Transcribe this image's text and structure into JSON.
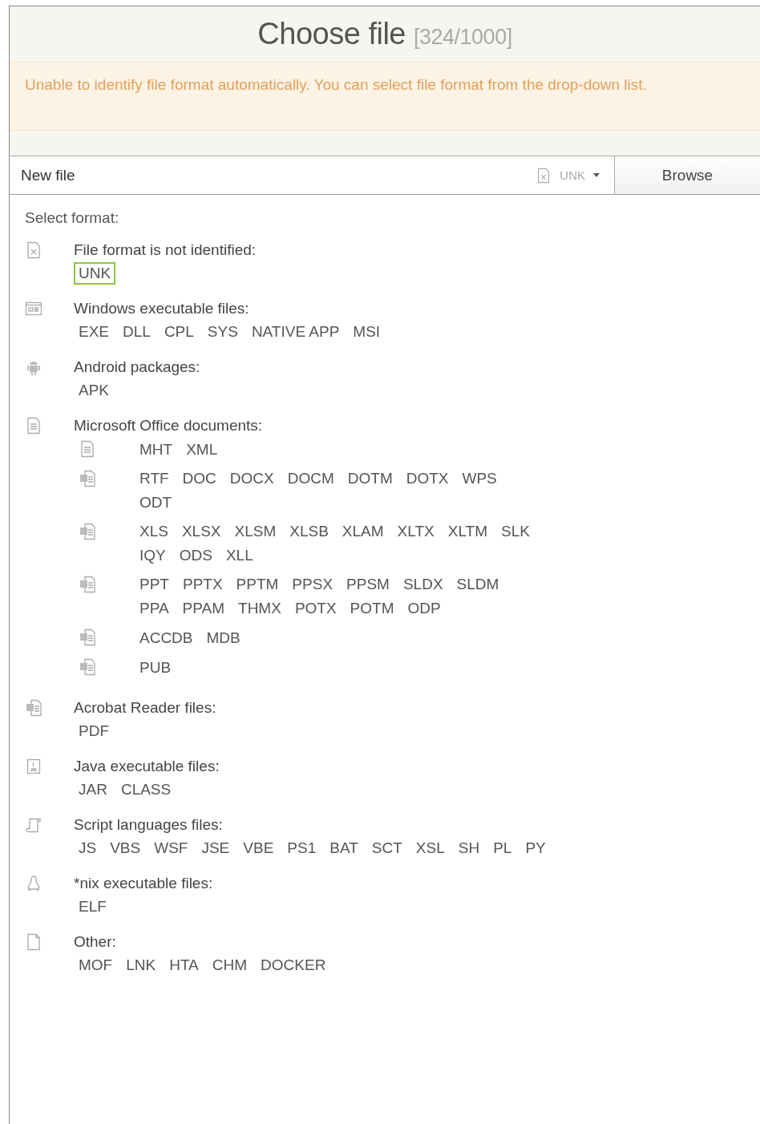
{
  "title": {
    "text": "Choose file",
    "counter": "[324/1000]"
  },
  "warning": "Unable to identify file format automatically. You can select file format from the drop-down list.",
  "file_row": {
    "name": "New file",
    "format": "UNK",
    "button": "Browse"
  },
  "select_label": "Select format:",
  "groups": [
    {
      "kind": "unknown",
      "label": "File format is not identified:",
      "formats": [
        {
          "label": "UNK",
          "selected": true
        }
      ]
    },
    {
      "kind": "window",
      "label": "Windows executable files:",
      "formats": [
        {
          "label": "EXE",
          "selected": false
        },
        {
          "label": "DLL",
          "selected": false
        },
        {
          "label": "CPL",
          "selected": false
        },
        {
          "label": "SYS",
          "selected": false
        },
        {
          "label": "NATIVE APP",
          "selected": false
        },
        {
          "label": "MSI",
          "selected": false
        }
      ]
    },
    {
      "kind": "android",
      "label": "Android packages:",
      "formats": [
        {
          "label": "APK",
          "selected": false
        }
      ]
    },
    {
      "kind": "document",
      "label": "Microsoft Office documents:",
      "children": [
        {
          "kind": "document",
          "formats": [
            {
              "label": "MHT",
              "selected": false
            },
            {
              "label": "XML",
              "selected": false
            }
          ]
        },
        {
          "kind": "word",
          "formats": [
            {
              "label": "RTF",
              "selected": false
            },
            {
              "label": "DOC",
              "selected": false
            },
            {
              "label": "DOCX",
              "selected": false
            },
            {
              "label": "DOCM",
              "selected": false
            },
            {
              "label": "DOTM",
              "selected": false
            },
            {
              "label": "DOTX",
              "selected": false
            },
            {
              "label": "WPS",
              "selected": false
            },
            {
              "label": "ODT",
              "selected": false
            }
          ]
        },
        {
          "kind": "excel",
          "formats": [
            {
              "label": "XLS",
              "selected": false
            },
            {
              "label": "XLSX",
              "selected": false
            },
            {
              "label": "XLSM",
              "selected": false
            },
            {
              "label": "XLSB",
              "selected": false
            },
            {
              "label": "XLAM",
              "selected": false
            },
            {
              "label": "XLTX",
              "selected": false
            },
            {
              "label": "XLTM",
              "selected": false
            },
            {
              "label": "SLK",
              "selected": false
            },
            {
              "label": "IQY",
              "selected": false
            },
            {
              "label": "ODS",
              "selected": false
            },
            {
              "label": "XLL",
              "selected": false
            }
          ]
        },
        {
          "kind": "powerpoint",
          "formats": [
            {
              "label": "PPT",
              "selected": false
            },
            {
              "label": "PPTX",
              "selected": false
            },
            {
              "label": "PPTM",
              "selected": false
            },
            {
              "label": "PPSX",
              "selected": false
            },
            {
              "label": "PPSM",
              "selected": false
            },
            {
              "label": "SLDX",
              "selected": false
            },
            {
              "label": "SLDM",
              "selected": false
            },
            {
              "label": "PPA",
              "selected": false
            },
            {
              "label": "PPAM",
              "selected": false
            },
            {
              "label": "THMX",
              "selected": false
            },
            {
              "label": "POTX",
              "selected": false
            },
            {
              "label": "POTM",
              "selected": false
            },
            {
              "label": "ODP",
              "selected": false
            }
          ]
        },
        {
          "kind": "access",
          "formats": [
            {
              "label": "ACCDB",
              "selected": false
            },
            {
              "label": "MDB",
              "selected": false
            }
          ]
        },
        {
          "kind": "publisher",
          "formats": [
            {
              "label": "PUB",
              "selected": false
            }
          ]
        }
      ]
    },
    {
      "kind": "acrobat",
      "label": "Acrobat Reader files:",
      "formats": [
        {
          "label": "PDF",
          "selected": false
        }
      ]
    },
    {
      "kind": "java",
      "label": "Java executable files:",
      "formats": [
        {
          "label": "JAR",
          "selected": false
        },
        {
          "label": "CLASS",
          "selected": false
        }
      ]
    },
    {
      "kind": "script",
      "label": "Script languages files:",
      "formats": [
        {
          "label": "JS",
          "selected": false
        },
        {
          "label": "VBS",
          "selected": false
        },
        {
          "label": "WSF",
          "selected": false
        },
        {
          "label": "JSE",
          "selected": false
        },
        {
          "label": "VBE",
          "selected": false
        },
        {
          "label": "PS1",
          "selected": false
        },
        {
          "label": "BAT",
          "selected": false
        },
        {
          "label": "SCT",
          "selected": false
        },
        {
          "label": "XSL",
          "selected": false
        },
        {
          "label": "SH",
          "selected": false
        },
        {
          "label": "PL",
          "selected": false
        },
        {
          "label": "PY",
          "selected": false
        }
      ]
    },
    {
      "kind": "linux",
      "label": "*nix executable files:",
      "formats": [
        {
          "label": "ELF",
          "selected": false
        }
      ]
    },
    {
      "kind": "blank",
      "label": "Other:",
      "formats": [
        {
          "label": "MOF",
          "selected": false
        },
        {
          "label": "LNK",
          "selected": false
        },
        {
          "label": "HTA",
          "selected": false
        },
        {
          "label": "CHM",
          "selected": false
        },
        {
          "label": "DOCKER",
          "selected": false
        }
      ]
    }
  ]
}
